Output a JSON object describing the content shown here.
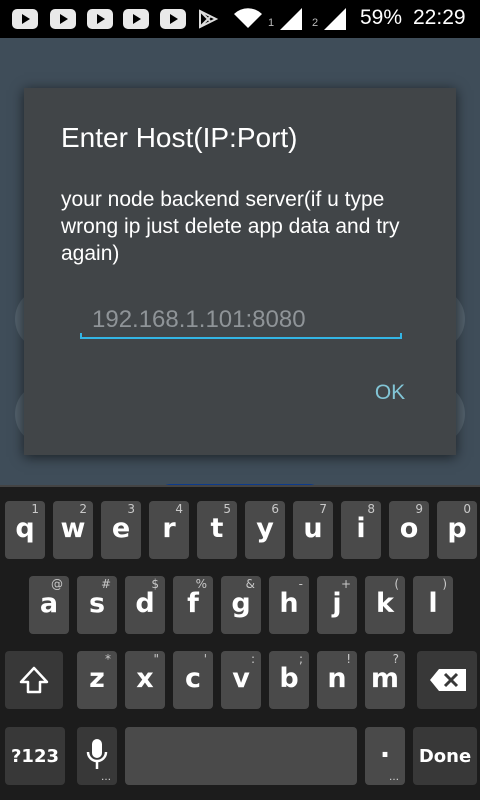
{
  "status_bar": {
    "sim1": "1",
    "sim2": "2",
    "battery": "59%",
    "time": "22:29"
  },
  "dialog": {
    "title": "Enter Host(IP:Port)",
    "message": "your node backend server(if u type wrong ip just delete app data and try again)",
    "host_placeholder": "192.168.1.101:8080",
    "ok_label": "OK"
  },
  "keyboard": {
    "row1": [
      {
        "char": "q",
        "hint": "1"
      },
      {
        "char": "w",
        "hint": "2"
      },
      {
        "char": "e",
        "hint": "3"
      },
      {
        "char": "r",
        "hint": "4"
      },
      {
        "char": "t",
        "hint": "5"
      },
      {
        "char": "y",
        "hint": "6"
      },
      {
        "char": "u",
        "hint": "7"
      },
      {
        "char": "i",
        "hint": "8"
      },
      {
        "char": "o",
        "hint": "9"
      },
      {
        "char": "p",
        "hint": "0"
      }
    ],
    "row2": [
      {
        "char": "a",
        "hint": "@"
      },
      {
        "char": "s",
        "hint": "#"
      },
      {
        "char": "d",
        "hint": "$"
      },
      {
        "char": "f",
        "hint": "%"
      },
      {
        "char": "g",
        "hint": "&"
      },
      {
        "char": "h",
        "hint": "-"
      },
      {
        "char": "j",
        "hint": "+"
      },
      {
        "char": "k",
        "hint": "("
      },
      {
        "char": "l",
        "hint": ")"
      }
    ],
    "row3": [
      {
        "char": "z",
        "hint": "*"
      },
      {
        "char": "x",
        "hint": "\""
      },
      {
        "char": "c",
        "hint": "'"
      },
      {
        "char": "v",
        "hint": ":"
      },
      {
        "char": "b",
        "hint": ";"
      },
      {
        "char": "n",
        "hint": "!"
      },
      {
        "char": "m",
        "hint": "?"
      }
    ],
    "symbols_label": "?123",
    "period_label": ".",
    "done_label": "Done",
    "shift_icon": "shift-icon",
    "backspace_icon": "backspace-icon",
    "mic_icon": "mic-icon"
  }
}
